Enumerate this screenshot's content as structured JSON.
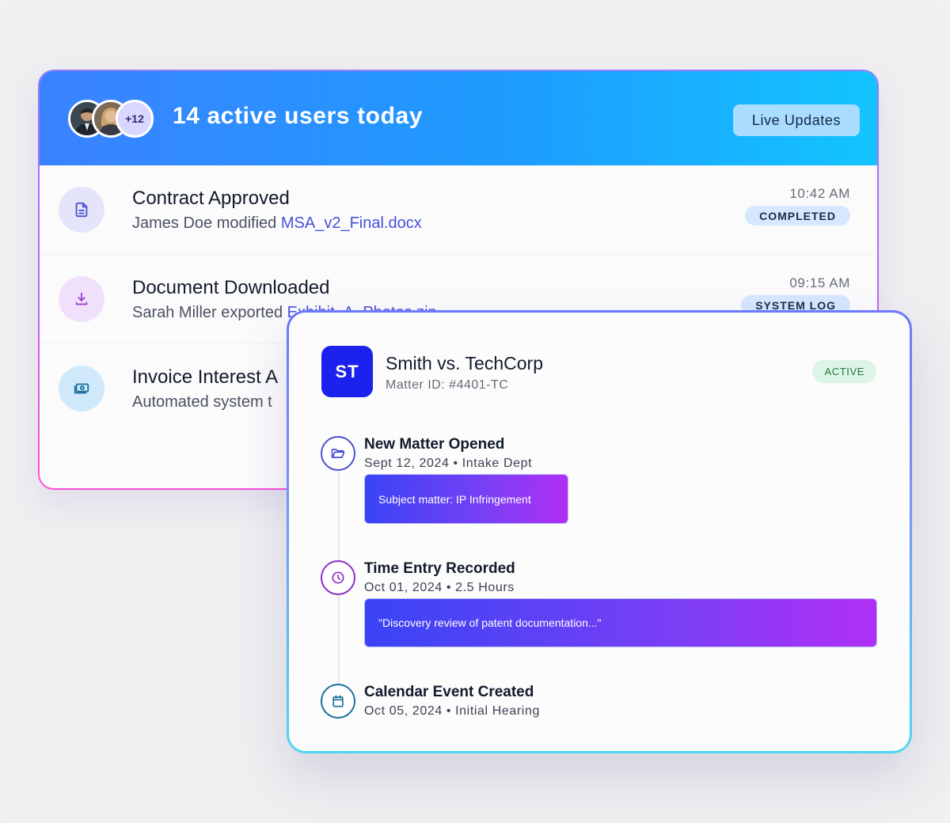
{
  "activity": {
    "avatars": {
      "more_label": "+12"
    },
    "header_title": "14 active users today",
    "live_button": "Live Updates",
    "feed": [
      {
        "title": "Contract Approved",
        "sub_prefix": "James Doe modified ",
        "sub_link": "MSA_v2_Final.docx",
        "time": "10:42 AM",
        "badge": "COMPLETED",
        "icon": "document-icon",
        "icon_bg": "#e4e4fb",
        "icon_color": "#4b4fd1"
      },
      {
        "title": "Document Downloaded",
        "sub_prefix": "Sarah Miller exported ",
        "sub_link": "Exhibit_A_Photos.zip",
        "time": "09:15 AM",
        "badge": "SYSTEM LOG",
        "icon": "download-icon",
        "icon_bg": "#f0e0fb",
        "icon_color": "#9b3fd0"
      },
      {
        "title": "Invoice Interest A",
        "sub_prefix": "Automated system t",
        "sub_link": "",
        "time": "",
        "badge": "",
        "icon": "cash-icon",
        "icon_bg": "#cfe9fb",
        "icon_color": "#1b6e9e"
      }
    ]
  },
  "matter": {
    "initials": "ST",
    "title": "Smith vs. TechCorp",
    "matter_id": "Matter ID: #4401-TC",
    "status": "ACTIVE",
    "timeline": [
      {
        "title": "New Matter Opened",
        "date": "Sept 12, 2024",
        "detail": "Intake Dept",
        "note": "Subject matter: IP Infringement",
        "icon": "folder-icon",
        "color": "#4b4fd1"
      },
      {
        "title": "Time Entry Recorded",
        "date": "Oct 01, 2024",
        "detail": "2.5 Hours",
        "note": "\"Discovery review of patent documentation...\"",
        "icon": "clock-icon",
        "color": "#8a2cc8"
      },
      {
        "title": "Calendar Event Created",
        "date": "Oct 05, 2024",
        "detail": "Initial Hearing",
        "note": "",
        "icon": "calendar-icon",
        "color": "#1b6e9e"
      }
    ]
  },
  "colors": {
    "header_gradient_start": "#3b82ff",
    "header_gradient_end": "#13c4ff",
    "matter_avatar": "#1b22ee",
    "link": "#4650d8",
    "status_active_bg": "#dcf5e6",
    "status_active_text": "#1d7a3e"
  }
}
